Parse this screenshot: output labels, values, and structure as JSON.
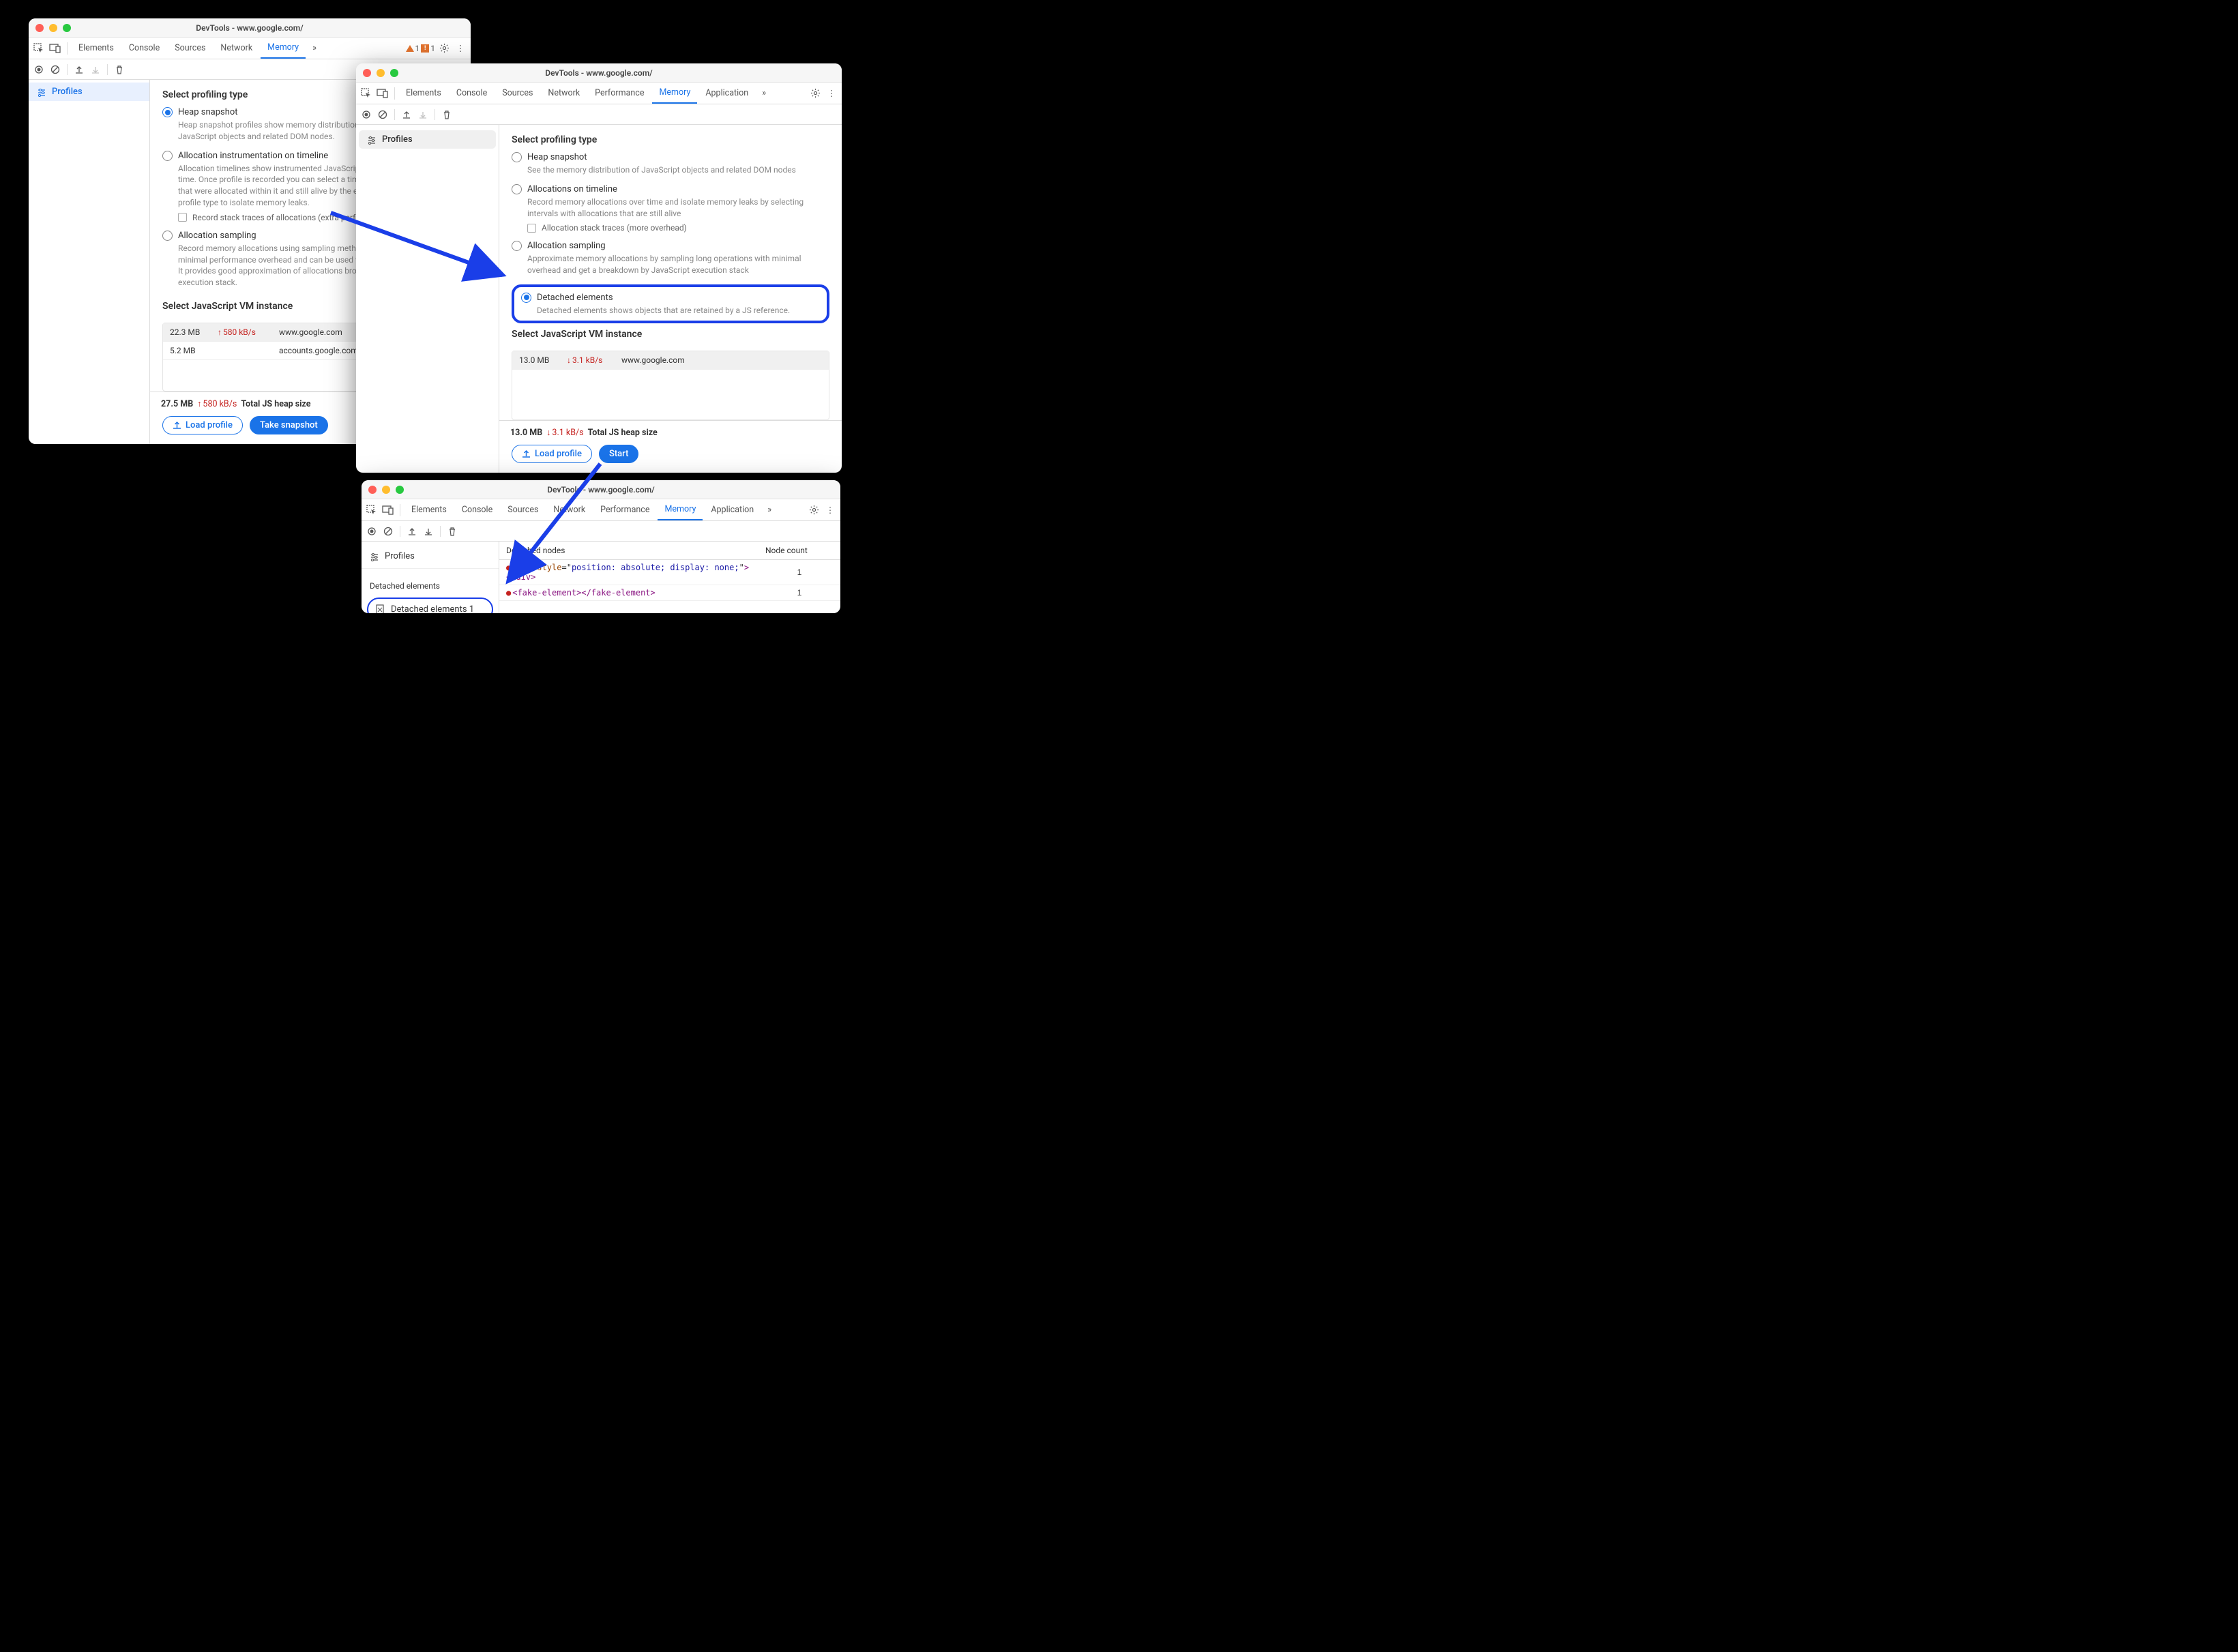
{
  "window1": {
    "title": "DevTools - www.google.com/",
    "tabs": [
      "Elements",
      "Console",
      "Sources",
      "Network",
      "Memory"
    ],
    "active_tab": "Memory",
    "warnings": {
      "issue_count": "1",
      "error_count": "1"
    },
    "sidebar": {
      "profiles": "Profiles"
    },
    "heading": "Select profiling type",
    "opts": {
      "heap": {
        "label": "Heap snapshot",
        "desc": "Heap snapshot profiles show memory distribution among your page's JavaScript objects and related DOM nodes."
      },
      "timeline": {
        "label": "Allocation instrumentation on timeline",
        "desc": "Allocation timelines show instrumented JavaScript memory allocations over time. Once profile is recorded you can select a time interval to see objects that were allocated within it and still alive by the end of recording. Use this profile type to isolate memory leaks.",
        "cb": "Record stack traces of allocations (extra performance overhead)"
      },
      "sampling": {
        "label": "Allocation sampling",
        "desc": "Record memory allocations using sampling method. This profile type has minimal performance overhead and can be used for long running operations. It provides good approximation of allocations broken down by JavaScript execution stack."
      }
    },
    "vm_heading": "Select JavaScript VM instance",
    "vm_rows": [
      {
        "size": "22.3 MB",
        "rate": "580 kB/s",
        "url": "www.google.com"
      },
      {
        "size": "5.2 MB",
        "rate": "",
        "url": "accounts.google.com: Rollup"
      }
    ],
    "footer": {
      "total_size": "27.5 MB",
      "total_rate": "580 kB/s",
      "total_label": "Total JS heap size",
      "load": "Load profile",
      "action": "Take snapshot"
    }
  },
  "window2": {
    "title": "DevTools - www.google.com/",
    "tabs": [
      "Elements",
      "Console",
      "Sources",
      "Network",
      "Performance",
      "Memory",
      "Application"
    ],
    "active_tab": "Memory",
    "sidebar": {
      "profiles": "Profiles"
    },
    "heading": "Select profiling type",
    "opts": {
      "heap": {
        "label": "Heap snapshot",
        "desc": "See the memory distribution of JavaScript objects and related DOM nodes"
      },
      "timeline": {
        "label": "Allocations on timeline",
        "desc": "Record memory allocations over time and isolate memory leaks by selecting intervals with allocations that are still alive",
        "cb": "Allocation stack traces (more overhead)"
      },
      "sampling": {
        "label": "Allocation sampling",
        "desc": "Approximate memory allocations by sampling long operations with minimal overhead and get a breakdown by JavaScript execution stack"
      },
      "detached": {
        "label": "Detached elements",
        "desc": "Detached elements shows objects that are retained by a JS reference."
      }
    },
    "vm_heading": "Select JavaScript VM instance",
    "vm_rows": [
      {
        "size": "13.0 MB",
        "rate": "3.1 kB/s",
        "url": "www.google.com"
      }
    ],
    "footer": {
      "total_size": "13.0 MB",
      "total_rate": "3.1 kB/s",
      "total_label": "Total JS heap size",
      "load": "Load profile",
      "action": "Start"
    }
  },
  "window3": {
    "title": "DevTools - www.google.com/",
    "tabs": [
      "Elements",
      "Console",
      "Sources",
      "Network",
      "Performance",
      "Memory",
      "Application"
    ],
    "active_tab": "Memory",
    "sidebar": {
      "profiles": "Profiles",
      "section": "Detached elements",
      "snapshot": "Detached elements 1"
    },
    "table": {
      "head_nodes": "Detached nodes",
      "head_count": "Node count",
      "rows": [
        {
          "html": "<div style=\"position: absolute; display: none;\"></div>",
          "count": "1"
        },
        {
          "html": "<fake-element></fake-element>",
          "count": "1"
        }
      ]
    }
  }
}
